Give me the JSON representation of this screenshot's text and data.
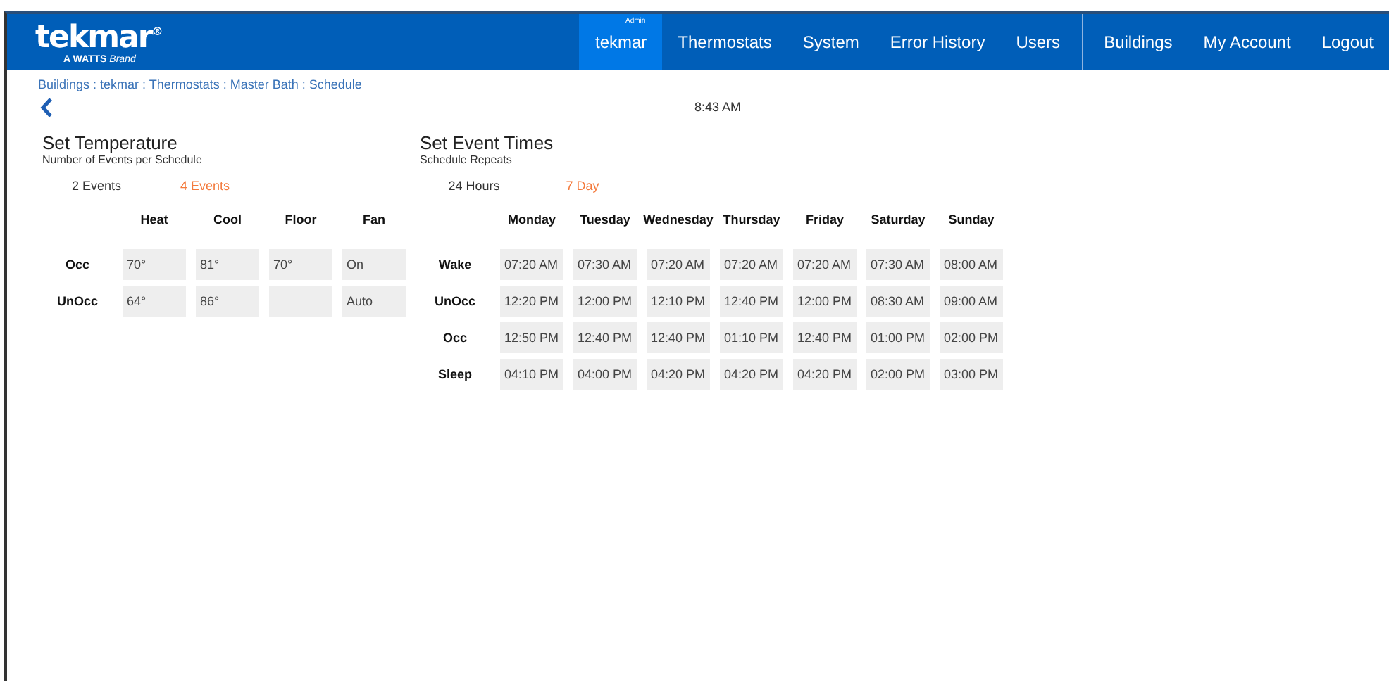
{
  "header": {
    "logo": "tekmar",
    "logo_mark": "®",
    "tagline_brand": "A WATTS",
    "tagline_rest": "Brand",
    "nav": [
      {
        "label": "tekmar",
        "badge": "Admin",
        "selected": true
      },
      {
        "label": "Thermostats",
        "selected": false
      },
      {
        "label": "System",
        "selected": false
      },
      {
        "label": "Error History",
        "selected": false
      },
      {
        "label": "Users",
        "selected": false
      }
    ],
    "nav_right": [
      "Buildings",
      "My Account",
      "Logout"
    ]
  },
  "breadcrumb": "Buildings : tekmar : Thermostats : Master Bath : Schedule",
  "time": "8:43 AM",
  "temperature": {
    "title": "Set Temperature",
    "subtitle": "Number of Events per Schedule",
    "options": [
      {
        "label": "2 Events",
        "selected": false
      },
      {
        "label": "4 Events",
        "selected": true
      }
    ],
    "columns": [
      "Heat",
      "Cool",
      "Floor",
      "Fan"
    ],
    "rows": [
      {
        "label": "Occ",
        "cells": [
          "70°",
          "81°",
          "70°",
          "On"
        ]
      },
      {
        "label": "UnOcc",
        "cells": [
          "64°",
          "86°",
          null,
          "Auto"
        ]
      }
    ]
  },
  "events": {
    "title": "Set Event Times",
    "subtitle": "Schedule Repeats",
    "options": [
      {
        "label": "24 Hours",
        "selected": false
      },
      {
        "label": "7 Day",
        "selected": true
      }
    ],
    "columns": [
      "Monday",
      "Tuesday",
      "Wednesday",
      "Thursday",
      "Friday",
      "Saturday",
      "Sunday"
    ],
    "rows": [
      {
        "label": "Wake",
        "cells": [
          "07:20 AM",
          "07:30 AM",
          "07:20 AM",
          "07:20 AM",
          "07:20 AM",
          "07:30 AM",
          "08:00 AM"
        ]
      },
      {
        "label": "UnOcc",
        "cells": [
          "12:20 PM",
          "12:00 PM",
          "12:10 PM",
          "12:40 PM",
          "12:00 PM",
          "08:30 AM",
          "09:00 AM"
        ]
      },
      {
        "label": "Occ",
        "cells": [
          "12:50 PM",
          "12:40 PM",
          "12:40 PM",
          "01:10 PM",
          "12:40 PM",
          "01:00 PM",
          "02:00 PM"
        ]
      },
      {
        "label": "Sleep",
        "cells": [
          "04:10 PM",
          "04:00 PM",
          "04:20 PM",
          "04:20 PM",
          "04:20 PM",
          "02:00 PM",
          "03:00 PM"
        ]
      }
    ]
  }
}
